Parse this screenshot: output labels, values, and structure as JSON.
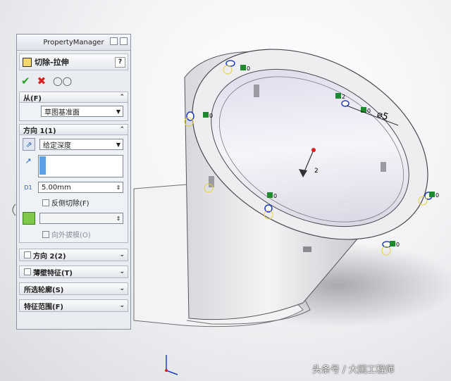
{
  "panel": {
    "title": "PropertyManager",
    "feature_title": "切除-拉伸",
    "help": "?",
    "from": {
      "label": "从(F)",
      "value": "草图基准面"
    },
    "direction1": {
      "label": "方向 1(1)",
      "end_condition": "给定深度",
      "depth": "5.00mm",
      "flip_side": "反侧切除(F)",
      "draft_outward": "向外拔模(O)"
    },
    "collapsed_sections": [
      {
        "label": "方向 2(2)"
      },
      {
        "label": "薄壁特征(T)"
      },
      {
        "label": "所选轮廓(S)"
      },
      {
        "label": "特征范围(F)"
      }
    ]
  },
  "viewport": {
    "dimension_label": "⌀5",
    "triad_label": "2",
    "relation_labels": [
      "0",
      "0",
      "0",
      "0",
      "0",
      "2",
      "0"
    ],
    "watermark": "头条号 / 大国工程师"
  },
  "colors": {
    "accent": "#1f5fbf",
    "ok": "#2aa02a",
    "cancel": "#d42020",
    "relation": "#1e8a2e"
  }
}
